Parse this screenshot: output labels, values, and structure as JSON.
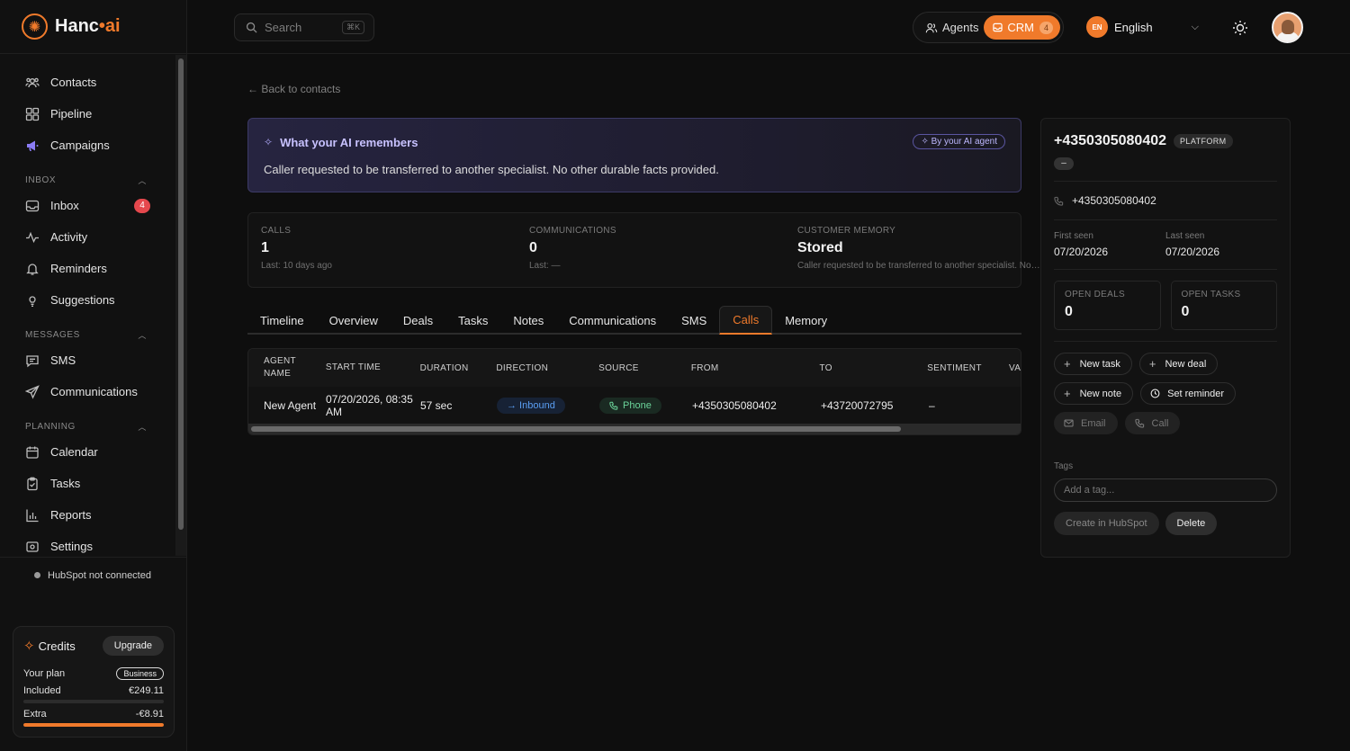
{
  "brand": {
    "name_main": "Hanc",
    "name_dot": "•",
    "name_ai": "ai"
  },
  "sidebar": {
    "top_items": [
      {
        "label": "Contacts",
        "icon": "contacts-icon"
      },
      {
        "label": "Pipeline",
        "icon": "pipeline-icon"
      },
      {
        "label": "Campaigns",
        "icon": "megaphone-icon"
      }
    ],
    "inbox_section": "INBOX",
    "inbox_items": [
      {
        "label": "Inbox",
        "badge": "4"
      },
      {
        "label": "Activity"
      },
      {
        "label": "Reminders"
      },
      {
        "label": "Suggestions"
      }
    ],
    "messages_section": "MESSAGES",
    "messages_items": [
      {
        "label": "SMS"
      },
      {
        "label": "Communications"
      }
    ],
    "planning_section": "PLANNING",
    "planning_items": [
      {
        "label": "Calendar"
      },
      {
        "label": "Tasks"
      },
      {
        "label": "Reports"
      },
      {
        "label": "Settings"
      }
    ],
    "hubspot_status": "HubSpot not connected",
    "credits": {
      "title": "Credits",
      "upgrade": "Upgrade",
      "plan_label": "Your plan",
      "plan_value": "Business",
      "included_label": "Included",
      "included_value": "€249.11",
      "included_fill": 0,
      "extra_label": "Extra",
      "extra_value": "-€8.91",
      "extra_fill": 1
    }
  },
  "topbar": {
    "search_placeholder": "Search",
    "search_kbd": "⌘K",
    "agents_label": "Agents",
    "crm_label": "CRM",
    "crm_count": "4",
    "lang_code": "EN",
    "lang_name": "English"
  },
  "main": {
    "back_link": "← Back to contacts",
    "memory": {
      "title": "What your AI remembers",
      "pill": "By your AI agent",
      "text": "Caller requested to be transferred to another specialist. No other durable facts provided."
    },
    "stats": [
      {
        "label": "CALLS",
        "value": "1",
        "sub": "Last: 10 days ago"
      },
      {
        "label": "COMMUNICATIONS",
        "value": "0",
        "sub": "Last: —"
      },
      {
        "label": "CUSTOMER MEMORY",
        "value": "Stored",
        "sub": "Caller requested to be transferred to another specialist. No other durable facts provided."
      }
    ],
    "tabs": [
      "Timeline",
      "Overview",
      "Deals",
      "Tasks",
      "Notes",
      "Communications",
      "SMS",
      "Calls",
      "Memory"
    ],
    "active_tab": "Calls",
    "table": {
      "headers": [
        "AGENT NAME",
        "START TIME",
        "DURATION",
        "DIRECTION",
        "SOURCE",
        "FROM",
        "TO",
        "SENTIMENT",
        "VA"
      ],
      "rows": [
        {
          "agent": "New Agent",
          "start": "07/20/2026, 08:35 AM",
          "duration": "57 sec",
          "direction": "→ Inbound",
          "source": "Phone",
          "from": "+4350305080402",
          "to": "+43720072795",
          "sentiment": "–"
        }
      ]
    }
  },
  "panel": {
    "phone_title": "+4350305080402",
    "platform": "PLATFORM",
    "dash": "–",
    "phone": "+4350305080402",
    "first_seen_label": "First seen",
    "first_seen": "07/20/2026",
    "last_seen_label": "Last seen",
    "last_seen": "07/20/2026",
    "open_deals_label": "OPEN DEALS",
    "open_deals": "0",
    "open_tasks_label": "OPEN TASKS",
    "open_tasks": "0",
    "actions": {
      "new_task": "New task",
      "new_deal": "New deal",
      "new_note": "New note",
      "set_reminder": "Set reminder",
      "email": "Email",
      "call": "Call"
    },
    "tags_label": "Tags",
    "tags_placeholder": "Add a tag...",
    "create_hubspot": "Create in HubSpot",
    "delete": "Delete"
  }
}
